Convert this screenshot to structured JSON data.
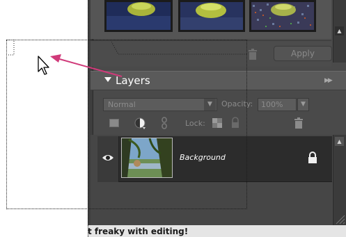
{
  "effects_panel": {
    "apply_label": "Apply"
  },
  "layers_panel": {
    "title": "Layers",
    "blend_mode": "Normal",
    "opacity_label": "Opacity:",
    "opacity_value": "100%",
    "lock_label": "Lock:",
    "layers": [
      {
        "name": "Background",
        "visible": true,
        "locked": true
      }
    ]
  },
  "status_bar": {
    "text": "t freaky with editing!"
  },
  "icons": {
    "visibility": "eye-icon",
    "lock": "lock-icon",
    "trash": "trash-icon",
    "panel_menu": "panel-menu-icon",
    "cursor": "arrow-cursor-icon"
  },
  "colors": {
    "panel_bg": "#4a4a4a",
    "drag_arrow": "#d03a7a",
    "selected_row": "#2c2c2c"
  }
}
